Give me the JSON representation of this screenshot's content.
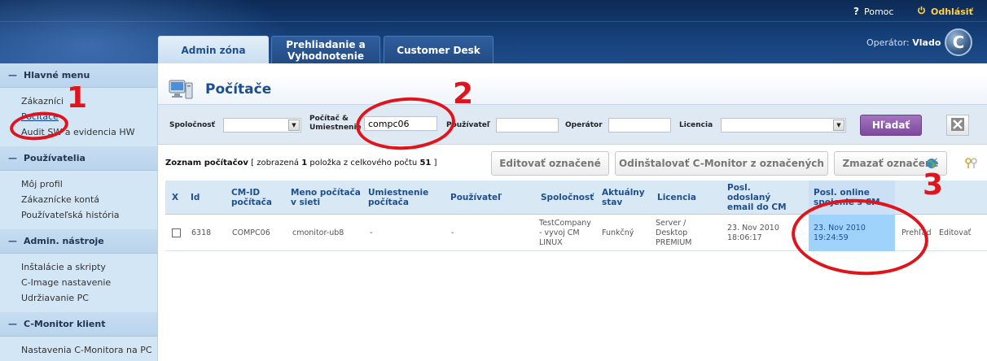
{
  "header": {
    "help_label": "Pomoc",
    "logout_label": "Odhlásiť",
    "operator_prefix": "Operátor:",
    "operator_name": "Vlado",
    "logo_letter": "C",
    "tabs": [
      {
        "label": "Admin zóna",
        "active": true
      },
      {
        "label": "Prehliadanie a Vyhodnotenie",
        "active": false
      },
      {
        "label": "Customer Desk",
        "active": false
      }
    ]
  },
  "sidebar": {
    "sections": [
      {
        "title": "Hlavné menu",
        "items": [
          "Zákazníci",
          "Počítače",
          "Audit SW a evidencia HW"
        ]
      },
      {
        "title": "Používatelia",
        "items": [
          "Môj profil",
          "Zákaznícke kontá",
          "Používateľská história"
        ]
      },
      {
        "title": "Admin. nástroje",
        "items": [
          "Inštalácie a skripty",
          "C-Image nastavenie",
          "Udržiavanie PC"
        ]
      },
      {
        "title": "C-Monitor klient",
        "items": [
          "Nastavenia C-Monitora na PC"
        ]
      }
    ],
    "current_item": "Počítače"
  },
  "page": {
    "title": "Počítače"
  },
  "filters": {
    "company_label": "Spoločnosť",
    "computer_label_line1": "Počítač &",
    "computer_label_line2": "Umiestnenie",
    "computer_value": "compc06",
    "user_label": "Používateľ",
    "operator_label": "Operátor",
    "license_label": "Licencia",
    "search_button": "Hľadať"
  },
  "list": {
    "caption_title": "Zoznam počítačov",
    "caption_prefix": "[ zobrazená",
    "shown_count": "1",
    "caption_middle": "položka z celkového počtu",
    "total_count": "51",
    "caption_suffix": "]",
    "edit_selected": "Editovať označené",
    "uninstall_selected": "Odinštalovať C-Monitor z označených",
    "delete_selected": "Zmazať označené"
  },
  "table": {
    "headers": [
      "X",
      "Id",
      "CM-ID počítača",
      "Meno počítača v sieti",
      "Umiestnenie počítača",
      "Používateľ",
      "Spoločnosť",
      "Aktuálny stav",
      "Licencia",
      "Posl. odoslaný email do CM",
      "Posl. online spojenie s CM"
    ],
    "row": {
      "id": "6318",
      "cm_id": "COMPC06",
      "name": "cmonitor-ub8",
      "location": "-",
      "user": "-",
      "company": "TestCompany - vyvoj CM LINUX",
      "status": "Funkčný",
      "license": "Server / Desktop PREMIUM",
      "last_email": "23. Nov 2010 18:06:17",
      "last_online": "23. Nov 2010 19:24:59",
      "view_link": "Prehľad",
      "edit_link": "Editovať"
    }
  },
  "annotations": [
    "1",
    "2",
    "3"
  ],
  "colors": {
    "accent_red": "#e0141c",
    "brand_blue": "#1d4f8f",
    "highlight_cell": "#9fd3fb",
    "search_button": "#8e5aac"
  }
}
